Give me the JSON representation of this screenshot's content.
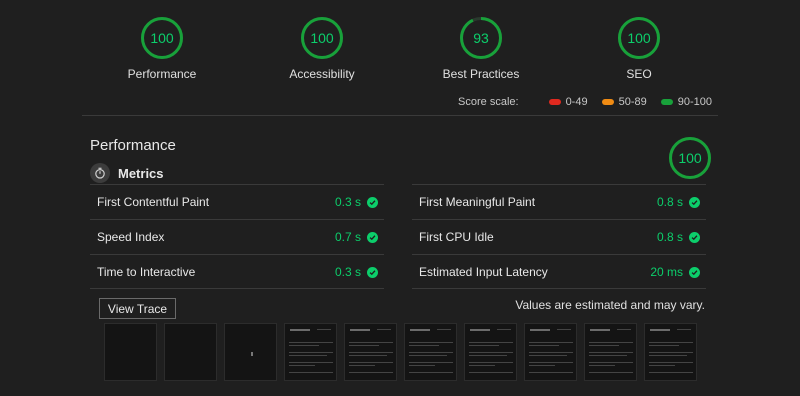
{
  "gauges": [
    {
      "label": "Performance",
      "score": "100",
      "fraction": 1.0
    },
    {
      "label": "Accessibility",
      "score": "100",
      "fraction": 1.0
    },
    {
      "label": "Best Practices",
      "score": "93",
      "fraction": 0.93
    },
    {
      "label": "SEO",
      "score": "100",
      "fraction": 1.0
    }
  ],
  "scale": {
    "title": "Score scale:",
    "items": [
      {
        "label": "0-49",
        "color": "#e0291f"
      },
      {
        "label": "50-89",
        "color": "#f08b13"
      },
      {
        "label": "90-100",
        "color": "#18a13a"
      }
    ]
  },
  "category": {
    "title": "Performance",
    "score": "100",
    "fraction": 1.0
  },
  "metrics": {
    "label": "Metrics",
    "icon": "stopwatch-icon",
    "left": [
      {
        "name": "First Contentful Paint",
        "value": "0.3 s"
      },
      {
        "name": "Speed Index",
        "value": "0.7 s"
      },
      {
        "name": "Time to Interactive",
        "value": "0.3 s"
      }
    ],
    "right": [
      {
        "name": "First Meaningful Paint",
        "value": "0.8 s"
      },
      {
        "name": "First CPU Idle",
        "value": "0.8 s"
      },
      {
        "name": "Estimated Input Latency",
        "value": "20 ms"
      }
    ]
  },
  "view_trace_label": "View Trace",
  "estimate_note": "Values are estimated and may vary.",
  "colors": {
    "pass": "#0cce6b",
    "ring": "#18a13a",
    "ring_track": "#2a3a2e",
    "background": "#1f1f1f"
  }
}
